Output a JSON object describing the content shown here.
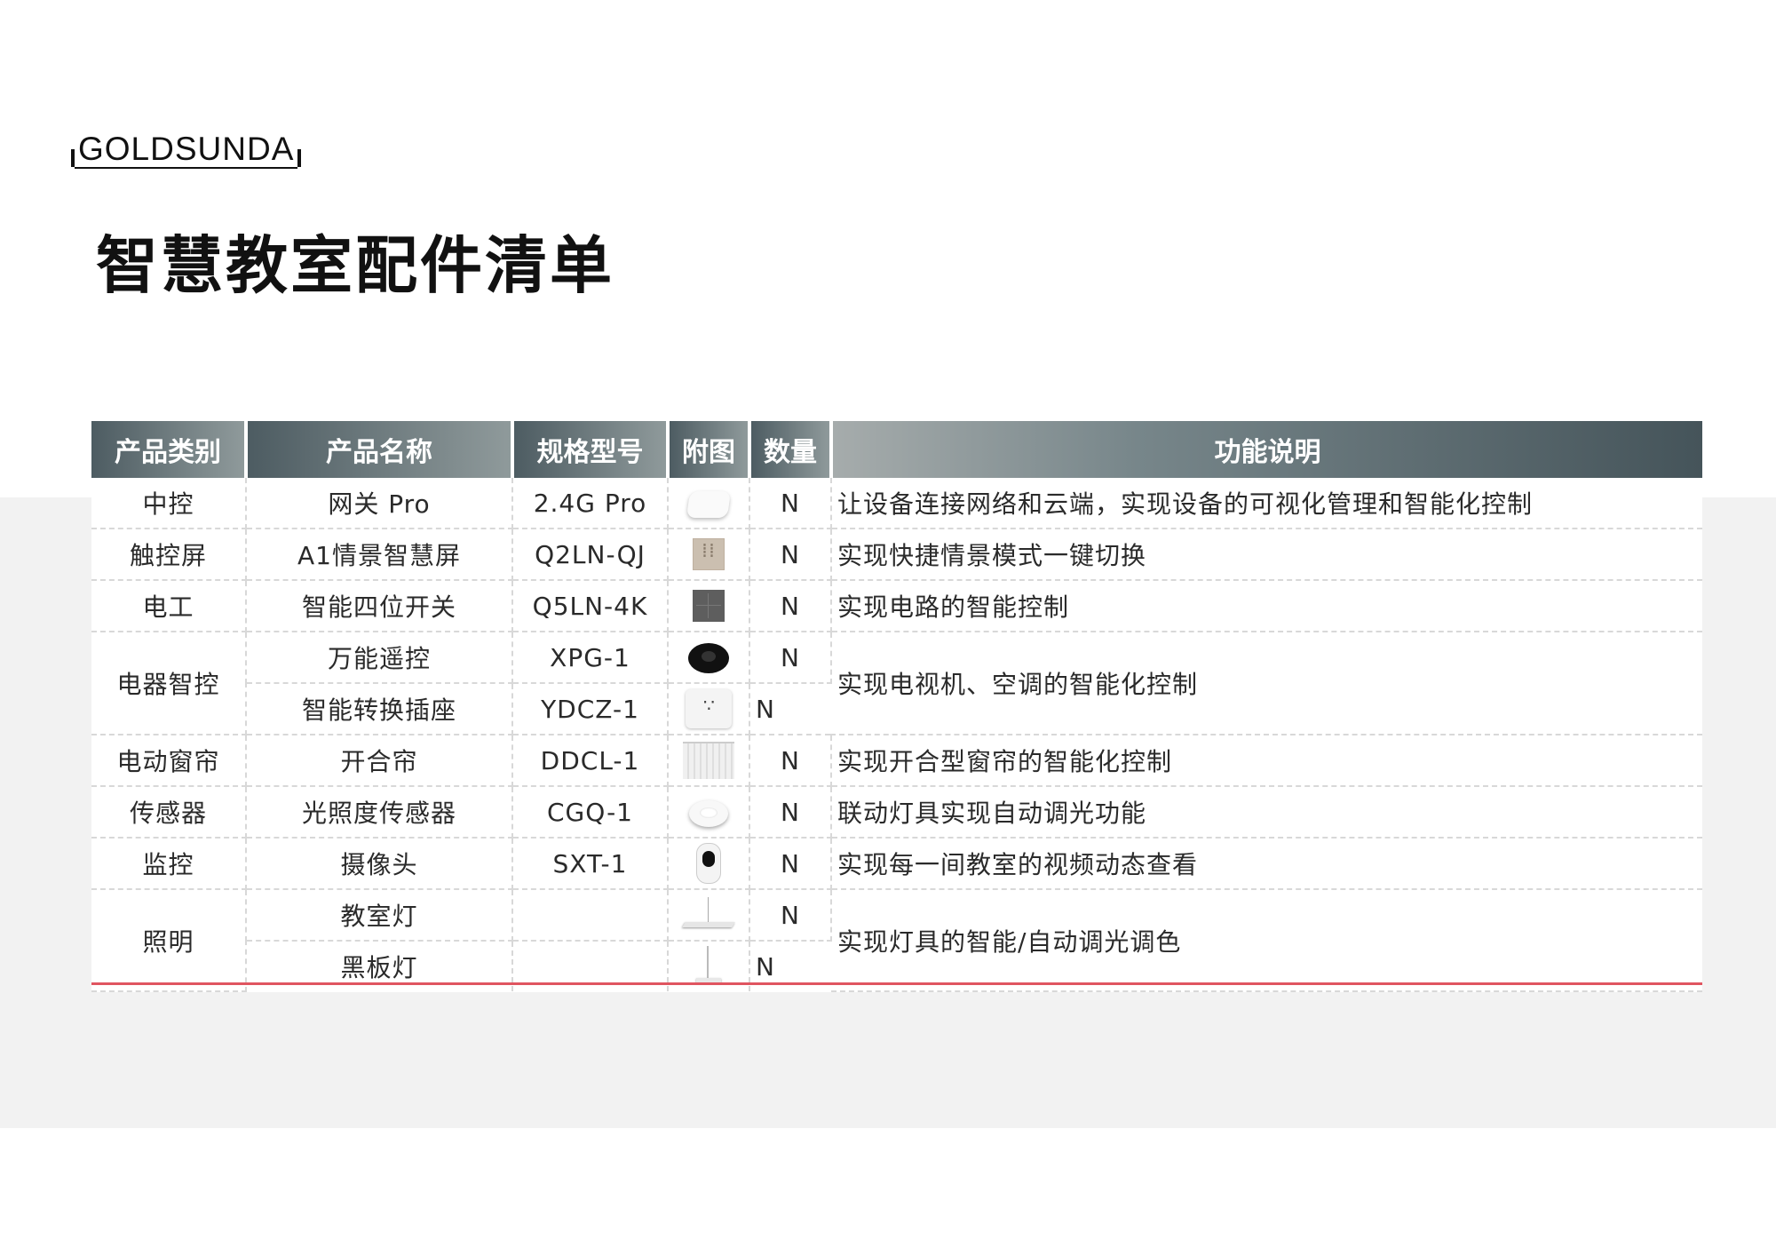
{
  "brand": "GOLDSUNDA",
  "title": "智慧教室配件清单",
  "table": {
    "headers": [
      "产品类别",
      "产品名称",
      "规格型号",
      "附图",
      "数量",
      "功能说明"
    ],
    "groups": [
      {
        "category": "中控",
        "description": "让设备连接网络和云端，实现设备的可视化管理和智能化控制",
        "items": [
          {
            "name": "网关 Pro",
            "model": "2.4G Pro",
            "image": "gateway-icon",
            "qty": "N"
          }
        ]
      },
      {
        "category": "触控屏",
        "description": "实现快捷情景模式一键切换",
        "items": [
          {
            "name": "A1情景智慧屏",
            "model": "Q2LN-QJ",
            "image": "touch-screen-icon",
            "qty": "N"
          }
        ]
      },
      {
        "category": "电工",
        "description": "实现电路的智能控制",
        "items": [
          {
            "name": "智能四位开关",
            "model": "Q5LN-4K",
            "image": "four-gang-switch-icon",
            "qty": "N"
          }
        ]
      },
      {
        "category": "电器智控",
        "description": "实现电视机、空调的智能化控制",
        "items": [
          {
            "name": "万能遥控",
            "model": "XPG-1",
            "image": "remote-control-icon",
            "qty": "N"
          },
          {
            "name": "智能转换插座",
            "model": "YDCZ-1",
            "image": "smart-socket-icon",
            "qty": "N"
          }
        ]
      },
      {
        "category": "电动窗帘",
        "description": "实现开合型窗帘的智能化控制",
        "items": [
          {
            "name": "开合帘",
            "model": "DDCL-1",
            "image": "curtain-icon",
            "qty": "N"
          }
        ]
      },
      {
        "category": "传感器",
        "description": "联动灯具实现自动调光功能",
        "items": [
          {
            "name": "光照度传感器",
            "model": "CGQ-1",
            "image": "light-sensor-icon",
            "qty": "N"
          }
        ]
      },
      {
        "category": "监控",
        "description": "实现每一间教室的视频动态查看",
        "items": [
          {
            "name": "摄像头",
            "model": "SXT-1",
            "image": "camera-icon",
            "qty": "N"
          }
        ]
      },
      {
        "category": "照明",
        "description": "实现灯具的智能/自动调光调色",
        "items": [
          {
            "name": "教室灯",
            "model": "",
            "image": "classroom-lamp-icon",
            "qty": "N"
          },
          {
            "name": "黑板灯",
            "model": "",
            "image": "blackboard-lamp-icon",
            "qty": "N"
          }
        ]
      }
    ]
  }
}
